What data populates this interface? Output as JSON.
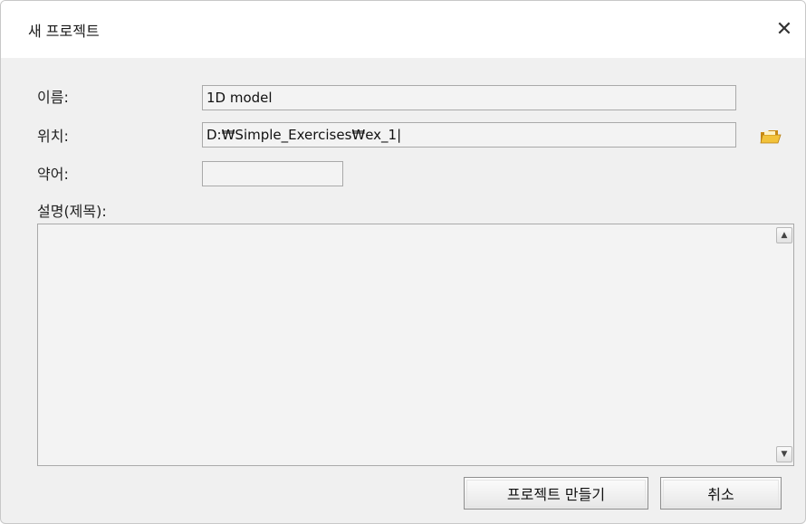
{
  "dialog": {
    "title": "새 프로젝트",
    "close_symbol": "✕"
  },
  "form": {
    "name": {
      "label": "이름:",
      "value": "1D model"
    },
    "location": {
      "label": "위치:",
      "value": "D:₩Simple_Exercises₩ex_1|",
      "browse_icon": "folder-icon"
    },
    "abbreviation": {
      "label": "약어:",
      "value": ""
    },
    "description": {
      "label": "설명(제목):",
      "value": ""
    }
  },
  "scrollbar": {
    "up": "▲",
    "down": "▼"
  },
  "buttons": {
    "create_label": "프로젝트 만들기",
    "cancel_label": "취소"
  },
  "colors": {
    "dialog_bg": "#f0f0f0",
    "titlebar_bg": "#ffffff",
    "field_bg": "#f3f3f3",
    "field_border": "#a9a9a9",
    "folder_icon": "#e8b230"
  }
}
